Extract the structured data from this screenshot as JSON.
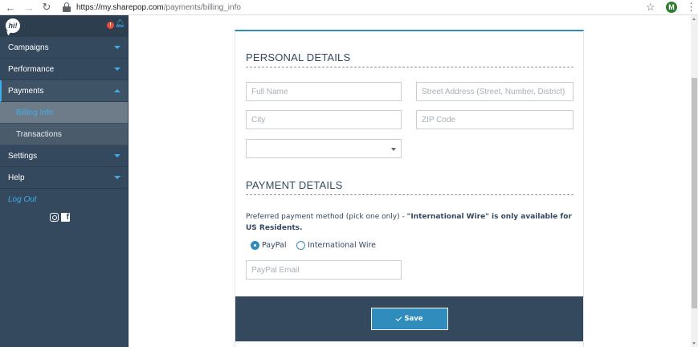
{
  "browser": {
    "url_host": "https://my.sharepop.com",
    "url_path": "/payments/billing_info",
    "avatar_letter": "M"
  },
  "sidebar": {
    "logo_text": "hi!",
    "alert_badge": "!",
    "items": [
      {
        "label": "Campaigns"
      },
      {
        "label": "Performance"
      },
      {
        "label": "Payments"
      },
      {
        "label": "Settings"
      },
      {
        "label": "Help"
      }
    ],
    "payments_sub": [
      {
        "label": "Billing Info"
      },
      {
        "label": "Transactions"
      }
    ],
    "logout_label": "Log Out",
    "accent_color": "#3daee9"
  },
  "personal": {
    "title": "PERSONAL DETAILS",
    "full_name_placeholder": "Full Name",
    "street_placeholder": "Street Address (Street, Number, District)",
    "city_placeholder": "City",
    "zip_placeholder": "ZIP Code",
    "country_value": ""
  },
  "payment": {
    "title": "PAYMENT DETAILS",
    "note_plain": "Preferred payment method (pick one only) - ",
    "note_bold": "\"International Wire\" is only available for US Residents.",
    "option_paypal": "PayPal",
    "option_wire": "International Wire",
    "selected_option": "PayPal",
    "paypal_email_placeholder": "PayPal Email"
  },
  "footer": {
    "save_label": "Save"
  }
}
